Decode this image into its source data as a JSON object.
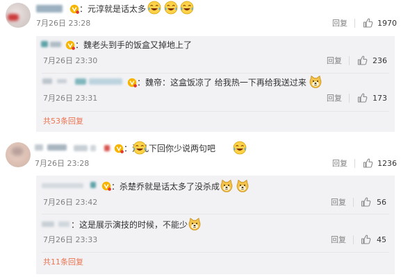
{
  "comments": [
    {
      "text": "：元淳就是话太多",
      "time": "7月26日 23:28",
      "reply_label": "回复",
      "likes": "1970",
      "emojis": [
        "laugh-cry-emoji",
        "laugh-cry-emoji",
        "laugh-cry-emoji"
      ],
      "replies": [
        {
          "text": "：魏老头到手的饭盒又掉地上了",
          "time": "7月26日 23:30",
          "reply_label": "回复",
          "likes": "236"
        },
        {
          "text": "：魏帝：这盒饭凉了 给我热一下再给我送过来",
          "time": "7月26日 23:31",
          "reply_label": "回复",
          "likes": "173",
          "emojis": [
            "doge-emoji"
          ]
        }
      ],
      "more_label": "共53条回复"
    },
    {
      "text": "：淳儿下回你少说两句吧",
      "time": "7月26日 23:28",
      "reply_label": "回复",
      "likes": "1236",
      "emojis": [
        "laugh-cry-emoji",
        "laugh-cry-emoji"
      ],
      "replies": [
        {
          "text": "：杀楚乔就是话太多了没杀成",
          "time": "7月26日 23:42",
          "reply_label": "回复",
          "likes": "56",
          "emojis": [
            "doge-emoji",
            "doge-emoji"
          ]
        },
        {
          "text": "：这是展示演技的时候，不能少",
          "time": "7月26日 23:33",
          "reply_label": "回复",
          "likes": "45",
          "emojis": [
            "doge-emoji"
          ]
        }
      ],
      "more_label": "共11条回复"
    }
  ],
  "colors": {
    "link": "#eb7350",
    "time": "#808080",
    "reply_bg": "#f2f2f5",
    "vip_badge": "#f7b500"
  },
  "icons": {
    "like": "thumb-up-icon",
    "vip": "vip-badge-icon"
  }
}
